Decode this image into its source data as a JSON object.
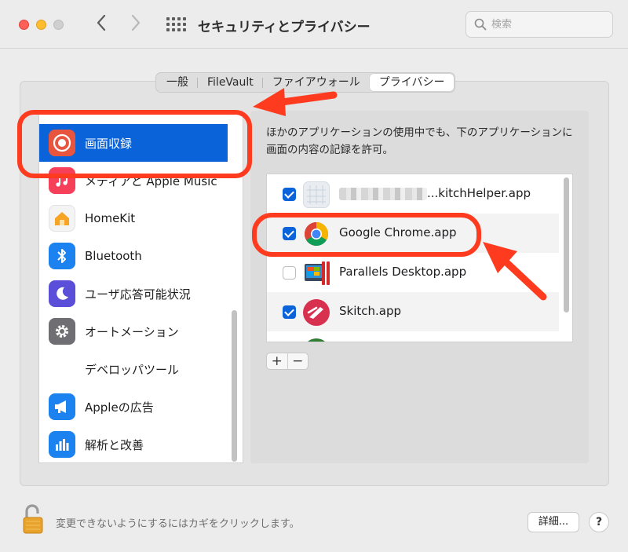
{
  "window": {
    "title": "セキュリティとプライバシー"
  },
  "search": {
    "placeholder": "検索"
  },
  "tabs": [
    {
      "label": "一般"
    },
    {
      "label": "FileVault"
    },
    {
      "label": "ファイアウォール"
    },
    {
      "label": "プライバシー",
      "active": true
    }
  ],
  "sidebar": {
    "items": [
      {
        "label": "画面収録",
        "icon": "screen-record-icon",
        "selected": true
      },
      {
        "label": "メディアと Apple Music",
        "icon": "music-icon"
      },
      {
        "label": "HomeKit",
        "icon": "home-icon"
      },
      {
        "label": "Bluetooth",
        "icon": "bluetooth-icon"
      },
      {
        "label": "ユーザ応答可能状況",
        "icon": "moon-icon"
      },
      {
        "label": "オートメーション",
        "icon": "gear-icon"
      },
      {
        "label": "デベロッパツール",
        "icon": ""
      },
      {
        "label": "Appleの広告",
        "icon": "megaphone-icon"
      },
      {
        "label": "解析と改善",
        "icon": "chart-icon"
      }
    ]
  },
  "main": {
    "description": "ほかのアプリケーションの使用中でも、下のアプリケーションに画面の内容の記録を許可。",
    "apps": [
      {
        "name": "...kitchHelper.app",
        "checked": true,
        "icon": "blurred-app-icon"
      },
      {
        "name": "Google Chrome.app",
        "checked": true,
        "icon": "chrome-icon"
      },
      {
        "name": "Parallels Desktop.app",
        "checked": false,
        "icon": "parallels-icon"
      },
      {
        "name": "Skitch.app",
        "checked": true,
        "icon": "skitch-icon"
      }
    ],
    "add_label": "+",
    "remove_label": "−"
  },
  "footer": {
    "lock_text": "変更できないようにするにはカギをクリックします。",
    "details_label": "詳細...",
    "help_label": "?"
  },
  "colors": {
    "accent": "#0a63d8",
    "annotation": "#ff3b1f"
  }
}
